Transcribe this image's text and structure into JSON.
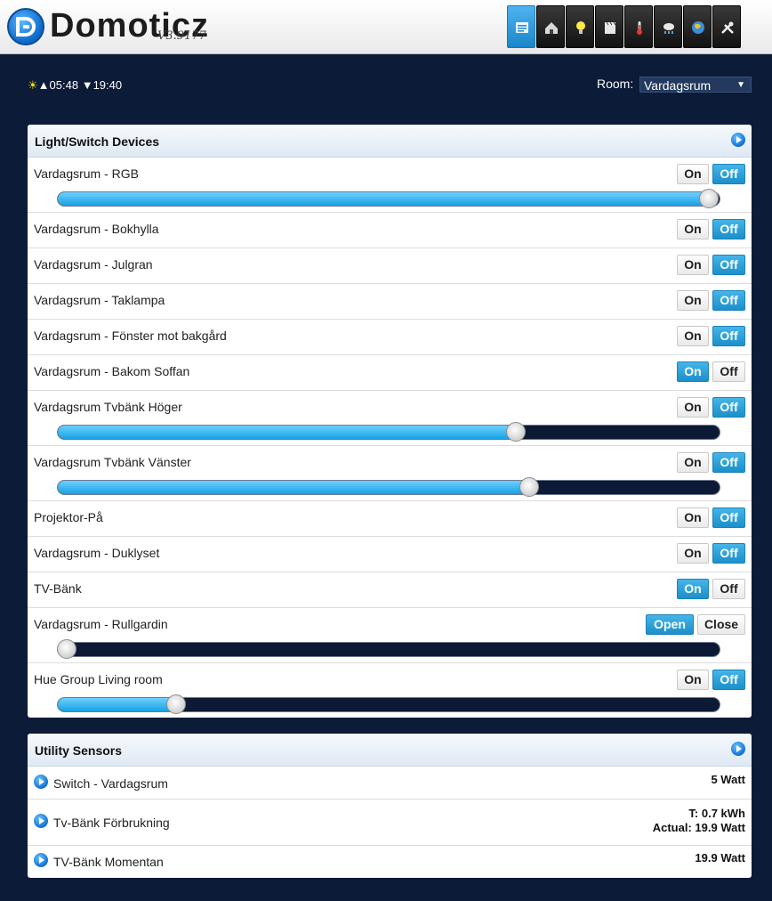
{
  "header": {
    "brand": "Domoticz",
    "version": "V3.9177",
    "nav": [
      {
        "icon": "dashboard-icon",
        "active": true
      },
      {
        "icon": "house-icon",
        "active": false
      },
      {
        "icon": "bulb-icon",
        "active": false
      },
      {
        "icon": "clapper-icon",
        "active": false
      },
      {
        "icon": "thermometer-icon",
        "active": false
      },
      {
        "icon": "weather-icon",
        "active": false
      },
      {
        "icon": "globe-icon",
        "active": false
      },
      {
        "icon": "tools-icon",
        "active": false
      }
    ]
  },
  "info": {
    "sunrise": "05:48",
    "sunset": "19:40",
    "room_label": "Room:",
    "room_value": "Vardagsrum"
  },
  "light_panel": {
    "title": "Light/Switch Devices",
    "devices": [
      {
        "name": "Vardagsrum - RGB",
        "on": "On",
        "off": "Off",
        "state": "off",
        "dim": 1.0
      },
      {
        "name": "Vardagsrum - Bokhylla",
        "on": "On",
        "off": "Off",
        "state": "off"
      },
      {
        "name": "Vardagsrum - Julgran",
        "on": "On",
        "off": "Off",
        "state": "off"
      },
      {
        "name": "Vardagsrum - Taklampa",
        "on": "On",
        "off": "Off",
        "state": "off"
      },
      {
        "name": "Vardagsrum - Fönster mot bakgård",
        "on": "On",
        "off": "Off",
        "state": "off"
      },
      {
        "name": "Vardagsrum - Bakom Soffan",
        "on": "On",
        "off": "Off",
        "state": "on"
      },
      {
        "name": "Vardagsrum Tvbänk Höger",
        "on": "On",
        "off": "Off",
        "state": "off",
        "dim": 0.7
      },
      {
        "name": "Vardagsrum Tvbänk Vänster",
        "on": "On",
        "off": "Off",
        "state": "off",
        "dim": 0.72
      },
      {
        "name": "Projektor-På",
        "on": "On",
        "off": "Off",
        "state": "off"
      },
      {
        "name": "Vardagsrum - Duklyset",
        "on": "On",
        "off": "Off",
        "state": "off"
      },
      {
        "name": "TV-Bänk",
        "on": "On",
        "off": "Off",
        "state": "on"
      },
      {
        "name": "Vardagsrum - Rullgardin",
        "on": "Open",
        "off": "Close",
        "state": "on",
        "dim": 0.0
      },
      {
        "name": "Hue Group Living room",
        "on": "On",
        "off": "Off",
        "state": "off",
        "dim": 0.17
      }
    ]
  },
  "utility_panel": {
    "title": "Utility Sensors",
    "sensors": [
      {
        "name": "Switch - Vardagsrum",
        "value1": "5 Watt",
        "value2": ""
      },
      {
        "name": "Tv-Bänk Förbrukning",
        "value1": "T: 0.7 kWh",
        "value2": "Actual: 19.9 Watt"
      },
      {
        "name": "TV-Bänk Momentan",
        "value1": "19.9 Watt",
        "value2": ""
      }
    ]
  },
  "colors": {
    "background": "#0b1b38",
    "accent": "#1c8fc9"
  }
}
